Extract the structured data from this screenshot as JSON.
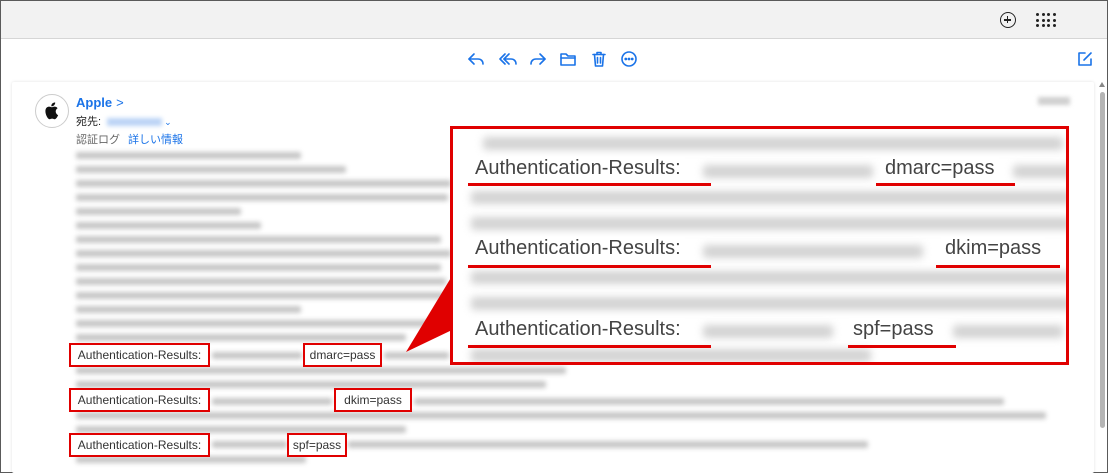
{
  "header": {
    "new_icon": "plus-circle-icon",
    "apps_icon": "grid-dots-icon"
  },
  "toolbar": {
    "icons": [
      "reply-icon",
      "reply-all-icon",
      "forward-icon",
      "folder-icon",
      "trash-icon",
      "more-icon",
      "compose-icon"
    ],
    "accent": "#1a73e8"
  },
  "message": {
    "sender": "Apple",
    "sender_chevron": ">",
    "to_label": "宛先:",
    "to_chevron": "⌄",
    "auth_label": "認証ログ",
    "details_link": "詳しい情報"
  },
  "highlights": {
    "dmarc_label": "Authentication-Results:",
    "dmarc_value": "dmarc=pass",
    "dkim_label": "Authentication-Results:",
    "dkim_value": "dkim=pass",
    "spf_label": "Authentication-Results:",
    "spf_value": "spf=pass",
    "color": "#e00000"
  },
  "callout": {
    "dmarc_label": "Authentication-Results:",
    "dmarc_value": "dmarc=pass",
    "dkim_label": "Authentication-Results:",
    "dkim_value": "dkim=pass",
    "spf_label": "Authentication-Results:",
    "spf_value": "spf=pass"
  }
}
